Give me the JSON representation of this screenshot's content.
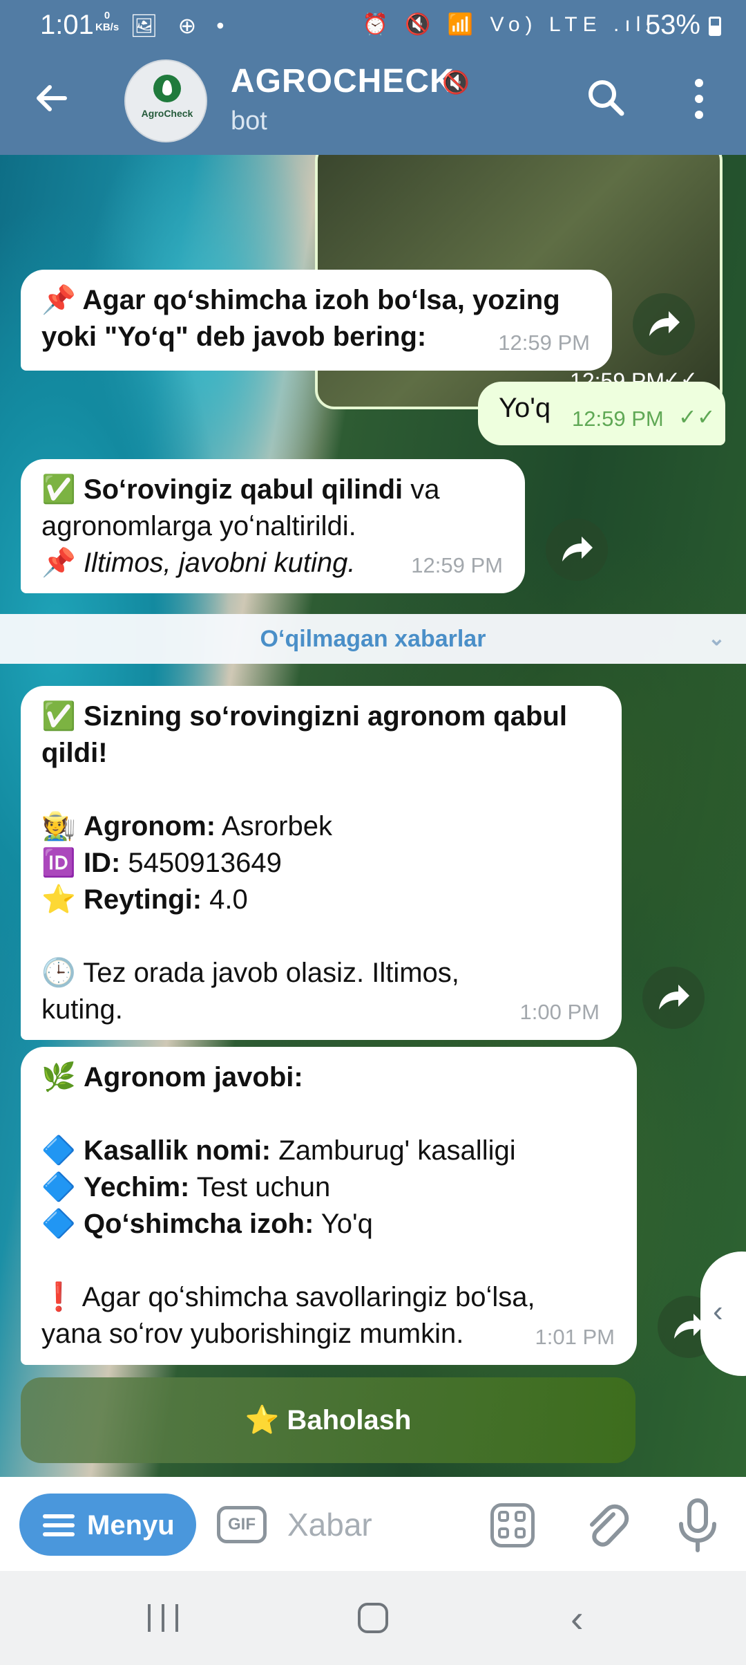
{
  "status_bar": {
    "time": "1:01",
    "net_speed_value": "0",
    "net_speed_unit": "KB/s",
    "left_icons": "🖼 ⊕ •",
    "right_icons": "⏰ 🔇 📶 Vo) LTE .ıll",
    "battery": "53%"
  },
  "header": {
    "title": "AGROCHECK",
    "subtitle": "bot",
    "avatar_text": "AgroCheck"
  },
  "photo_message": {
    "time": "12:59 PM",
    "ticks": "✓✓"
  },
  "messages": {
    "m1": {
      "text": "📌 Agar qoʻshimcha izoh boʻlsa, yozing yoki \"Yoʻq\" deb javob bering:",
      "time": "12:59 PM"
    },
    "m2": {
      "text": "Yo'q",
      "time": "12:59 PM",
      "ticks": "✓✓"
    },
    "m3": {
      "line1_emoji": "✅",
      "line1_bold": "Soʻrovingiz qabul qilindi",
      "line1_rest": " va agronomlarga yoʻnaltirildi.",
      "line2_emoji": "📌",
      "line2_italic": "Iltimos, javobni kuting.",
      "time": "12:59 PM"
    },
    "m4": {
      "head_emoji": "✅",
      "head": "Sizning soʻrovingizni agronom qabul qildi!",
      "agronom_emoji": "🧑‍🌾",
      "agronom_label": "Agronom:",
      "agronom_value": " Asrorbek",
      "id_emoji": "🆔",
      "id_label": "ID:",
      "id_value": " 5450913649",
      "rating_emoji": "⭐",
      "rating_label": "Reytingi:",
      "rating_value": " 4.0",
      "wait_emoji": "🕒",
      "wait": " Tez orada javob olasiz. Iltimos, kuting.",
      "time": "1:00 PM"
    },
    "m5": {
      "head_emoji": "🌿",
      "head": "Agronom javobi:",
      "disease_label": "Kasallik nomi:",
      "disease_value": " Zamburug' kasalligi",
      "solution_label": "Yechim:",
      "solution_value": " Test uchun",
      "extra_label": "Qoʻshimcha izoh:",
      "extra_value": " Yo'q",
      "bullet": "🔷",
      "warn_emoji": "❗",
      "footer": " Agar qoʻshimcha savollaringiz boʻlsa, yana soʻrov yuborishingiz mumkin.",
      "time": "1:01 PM"
    }
  },
  "unread_divider": "Oʻqilmagan xabarlar",
  "rate_button": "⭐ Baholash",
  "input_bar": {
    "menu_label": "Menyu",
    "gif_label": "GIF",
    "placeholder": "Xabar"
  },
  "colors": {
    "header_bg": "#527ca4",
    "menu_btn": "#4a97dc",
    "outgoing_bubble": "#eeffde",
    "unread_text": "#4a8fc8"
  }
}
